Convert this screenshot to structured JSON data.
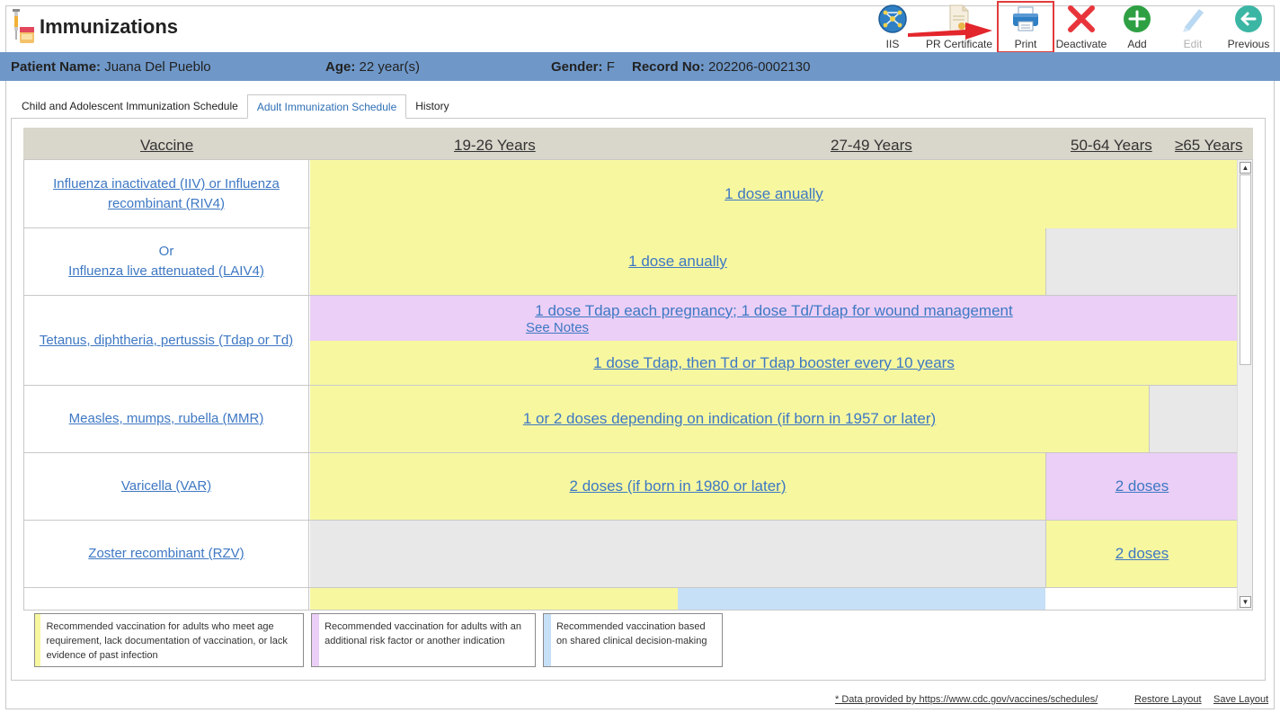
{
  "app": {
    "title": "Immunizations"
  },
  "toolbar": {
    "iis": "IIS",
    "pr_certificate": "PR Certificate",
    "print": "Print",
    "deactivate": "Deactivate",
    "add": "Add",
    "edit": "Edit",
    "previous": "Previous"
  },
  "patient": {
    "name_label": "Patient Name:",
    "name": "Juana Del Pueblo",
    "age_label": "Age:",
    "age": "22 year(s)",
    "gender_label": "Gender:",
    "gender": "F",
    "record_label": "Record No:",
    "record": "202206-0002130"
  },
  "tabs": [
    {
      "label": "Child and Adolescent Immunization Schedule"
    },
    {
      "label": "Adult Immunization Schedule"
    },
    {
      "label": "History"
    }
  ],
  "grid": {
    "headers": {
      "vaccine": "Vaccine",
      "age1": "19-26 Years",
      "age2": "27-49 Years",
      "age3": "50-64 Years",
      "age4": "≥65 Years"
    },
    "rows": [
      {
        "vaccine": "Influenza inactivated (IIV) or Influenza recombinant (RIV4)",
        "seg1": "1 dose anually"
      },
      {
        "or": "Or",
        "vaccine": "Influenza live attenuated (LAIV4)",
        "seg1": "1 dose anually"
      },
      {
        "vaccine": "Tetanus, diphtheria, pertussis (Tdap or Td)",
        "seg1": "1 dose Tdap each pregnancy; 1 dose Td/Tdap for wound management",
        "note": "See Notes",
        "seg2": "1 dose Tdap, then Td or Tdap booster every 10 years"
      },
      {
        "vaccine": "Measles, mumps, rubella (MMR)",
        "seg1": "1 or 2 doses depending on indication (if born in 1957 or later)"
      },
      {
        "vaccine": "Varicella (VAR)",
        "seg1": "2 doses (if born in 1980 or later)",
        "seg2": "2 doses"
      },
      {
        "vaccine": "Zoster recombinant (RZV)",
        "seg1": "2 doses"
      }
    ]
  },
  "legend": [
    {
      "text": "Recommended vaccination for adults who meet age requirement, lack documentation of vaccination, or lack evidence of past infection",
      "color": "#f7f7a0"
    },
    {
      "text": "Recommended vaccination for adults with an additional risk factor or another indication",
      "color": "#ebcff6"
    },
    {
      "text": "Recommended vaccination based on shared clinical decision-making",
      "color": "#c6e0f7"
    }
  ],
  "footer": {
    "source": "* Data provided by https://www.cdc.gov/vaccines/schedules/",
    "restore": "Restore Layout",
    "save": "Save Layout"
  },
  "colors": {
    "patient_bar": "#6f98c9",
    "link": "#3e78c3",
    "routine": "#f7f7a0",
    "risk": "#ebcff6",
    "shared": "#c6e0f7",
    "not_recommended": "#e8e8e8"
  }
}
